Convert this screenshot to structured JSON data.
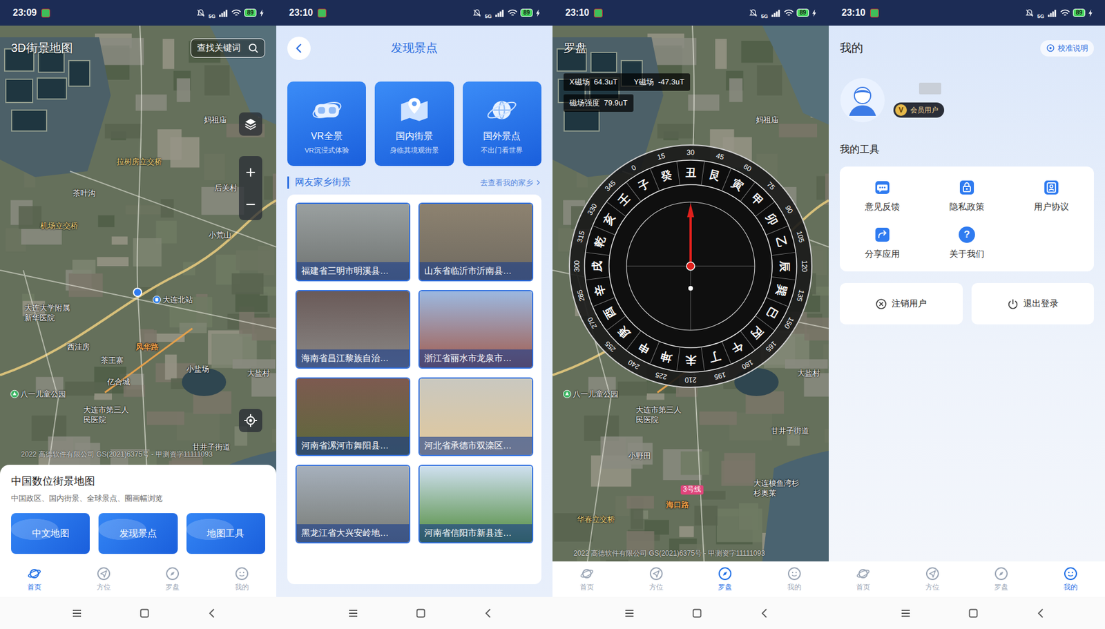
{
  "home": {
    "status": {
      "time": "23:09",
      "network": "5G",
      "battery": "89"
    },
    "title": "3D街景地图",
    "search": {
      "placeholder": "查找关键词"
    },
    "map_labels": [
      {
        "text": "妈祖庙",
        "kind": "place"
      },
      {
        "text": "拉树房立交桥",
        "kind": "interchange"
      },
      {
        "text": "茶叶沟",
        "kind": "place"
      },
      {
        "text": "后关村",
        "kind": "place"
      },
      {
        "text": "机场立交桥",
        "kind": "interchange"
      },
      {
        "text": "小荒山",
        "kind": "place"
      },
      {
        "text": "大连大学附属新华医院",
        "kind": "place"
      },
      {
        "text": "大连北站",
        "kind": "station"
      },
      {
        "text": "西洼房",
        "kind": "place"
      },
      {
        "text": "风华路",
        "kind": "road"
      },
      {
        "text": "茶王寨",
        "kind": "place"
      },
      {
        "text": "亿合城",
        "kind": "place"
      },
      {
        "text": "小盐场",
        "kind": "place"
      },
      {
        "text": "大盐村",
        "kind": "place"
      },
      {
        "text": "八一儿童公园",
        "kind": "park"
      },
      {
        "text": "大连市第三人民医院",
        "kind": "place"
      },
      {
        "text": "甘井子街道",
        "kind": "place"
      }
    ],
    "copyright": "2022 高德软件有限公司 GS(2021)6375号 - 甲测资字11111093",
    "panel": {
      "title": "中国数位街景地图",
      "subtitle": "中国政区、国内街景、全球景点、圈画幅浏览",
      "buttons": [
        "中文地图",
        "发现景点",
        "地图工具"
      ]
    },
    "tabs": [
      {
        "label": "首页",
        "selected": true
      },
      {
        "label": "方位",
        "selected": false
      },
      {
        "label": "罗盘",
        "selected": false
      },
      {
        "label": "我的",
        "selected": false
      }
    ]
  },
  "discover": {
    "status": {
      "time": "23:10",
      "network": "5G",
      "battery": "89"
    },
    "title": "发现景点",
    "features": [
      {
        "title": "VR全景",
        "subtitle": "VR沉浸式体验"
      },
      {
        "title": "国内街景",
        "subtitle": "身临其境观街景"
      },
      {
        "title": "国外景点",
        "subtitle": "不出门看世界"
      }
    ],
    "section": {
      "title": "网友家乡街景",
      "link": "去查看我的家乡"
    },
    "places": [
      {
        "label": "福建省三明市明溪县…"
      },
      {
        "label": "山东省临沂市沂南县…"
      },
      {
        "label": "海南省昌江黎族自治…"
      },
      {
        "label": "浙江省丽水市龙泉市…"
      },
      {
        "label": "河南省漯河市舞阳县…"
      },
      {
        "label": "河北省承德市双滦区…"
      },
      {
        "label": "黑龙江省大兴安岭地…"
      },
      {
        "label": "河南省信阳市新县连…"
      }
    ]
  },
  "compass": {
    "status": {
      "time": "23:10",
      "network": "5G",
      "battery": "89"
    },
    "title": "罗盘",
    "readings": [
      {
        "label": "X磁场",
        "value": "64.3uT"
      },
      {
        "label": "Y磁场",
        "value": "-47.3uT"
      },
      {
        "label": "磁场强度",
        "value": "79.9uT"
      }
    ],
    "dial": {
      "rotation": -30,
      "degrees": [
        "0",
        "15",
        "30",
        "45",
        "60",
        "75",
        "90",
        "105",
        "120",
        "135",
        "150",
        "165",
        "180",
        "195",
        "210",
        "225",
        "240",
        "255",
        "270",
        "285",
        "300",
        "315",
        "330",
        "345"
      ],
      "mountains": [
        "子",
        "癸",
        "丑",
        "艮",
        "寅",
        "甲",
        "卯",
        "乙",
        "辰",
        "巽",
        "巳",
        "丙",
        "午",
        "丁",
        "未",
        "坤",
        "申",
        "庚",
        "酉",
        "辛",
        "戌",
        "乾",
        "亥",
        "壬"
      ]
    },
    "map_labels": [
      {
        "text": "妈祖庙",
        "kind": "place"
      },
      {
        "text": "八一儿童公园",
        "kind": "park"
      },
      {
        "text": "大连市第三人民医院",
        "kind": "place"
      },
      {
        "text": "小野田",
        "kind": "place"
      },
      {
        "text": "3号线",
        "kind": "metro"
      },
      {
        "text": "海口路",
        "kind": "road"
      },
      {
        "text": "华春立交桥",
        "kind": "interchange"
      },
      {
        "text": "大连梭鱼湾杉杉奥莱",
        "kind": "place"
      },
      {
        "text": "甘井子街道",
        "kind": "place"
      },
      {
        "text": "大盐村",
        "kind": "place"
      }
    ],
    "copyright": "2022 高德软件有限公司 GS(2021)6375号 - 甲测资字11111093",
    "tabs": [
      {
        "label": "首页",
        "selected": false
      },
      {
        "label": "方位",
        "selected": false
      },
      {
        "label": "罗盘",
        "selected": true
      },
      {
        "label": "我的",
        "selected": false
      }
    ]
  },
  "mine": {
    "status": {
      "time": "23:10",
      "network": "5G",
      "battery": "89"
    },
    "title": "我的",
    "calibrate": "校准说明",
    "profile": {
      "badge_glyph": "V",
      "badge": "会员用户"
    },
    "tools_title": "我的工具",
    "tools": [
      {
        "label": "意见反馈"
      },
      {
        "label": "隐私政策"
      },
      {
        "label": "用户协议"
      },
      {
        "label": "分享应用"
      },
      {
        "label": "关于我们",
        "glyph": "?"
      }
    ],
    "actions": [
      "注销用户",
      "退出登录"
    ],
    "tabs": [
      {
        "label": "首页",
        "selected": false
      },
      {
        "label": "方位",
        "selected": false
      },
      {
        "label": "罗盘",
        "selected": false
      },
      {
        "label": "我的",
        "selected": true
      }
    ]
  }
}
